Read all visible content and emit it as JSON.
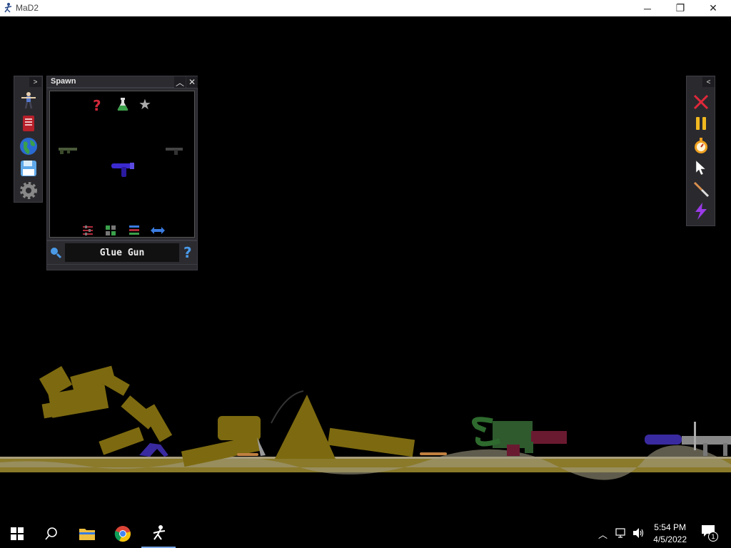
{
  "window": {
    "title": "MaD2",
    "minimize_icon": "minimize-icon",
    "restore_icon": "restore-icon",
    "close_icon": "close-icon"
  },
  "left_toolbar": {
    "items": [
      {
        "name": "ragdoll-icon"
      },
      {
        "name": "book-icon"
      },
      {
        "name": "globe-icon"
      },
      {
        "name": "save-icon"
      },
      {
        "name": "gear-icon"
      }
    ]
  },
  "spawn_panel": {
    "title": "Spawn",
    "category_icons": [
      "help-icon",
      "flask-icon",
      "star-icon"
    ],
    "items": [
      "rifle-icon",
      "glue-gun-icon",
      "pistol-icon"
    ],
    "bottom_icons": [
      "sort-icon",
      "grid-icon",
      "list-icon",
      "swap-icon"
    ],
    "selected_item": "Glue Gun"
  },
  "right_toolbar": {
    "items": [
      {
        "name": "delete-icon"
      },
      {
        "name": "pause-icon"
      },
      {
        "name": "stopwatch-icon"
      },
      {
        "name": "cursor-icon"
      },
      {
        "name": "knife-icon"
      },
      {
        "name": "lightning-icon"
      }
    ]
  },
  "taskbar": {
    "time": "5:54 PM",
    "date": "4/5/2022",
    "notification_count": "1"
  },
  "colors": {
    "accent_blue": "#3a7be0",
    "ground": "#8a7a2a",
    "ragdoll": "#7d6a10"
  }
}
